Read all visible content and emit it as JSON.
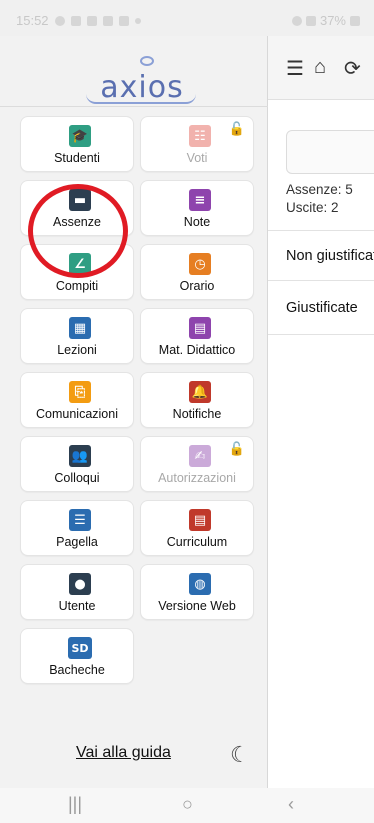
{
  "status_bar": {
    "time": "15:52",
    "battery": "37%"
  },
  "drawer": {
    "logo_text": "axios",
    "tiles": [
      {
        "label": "Studenti",
        "icon": "graduation-cap-icon",
        "color": "#2f9e83",
        "disabled": false
      },
      {
        "label": "Voti",
        "icon": "gradebook-icon",
        "color": "#e2574c",
        "disabled": true
      },
      {
        "label": "Assenze",
        "icon": "bed-icon",
        "color": "#2c3e50",
        "disabled": false
      },
      {
        "label": "Note",
        "icon": "note-icon",
        "color": "#8e44ad",
        "disabled": false
      },
      {
        "label": "Compiti",
        "icon": "chart-board-icon",
        "color": "#2f9e83",
        "disabled": false
      },
      {
        "label": "Orario",
        "icon": "clock-icon",
        "color": "#e67e22",
        "disabled": false
      },
      {
        "label": "Lezioni",
        "icon": "lesson-board-icon",
        "color": "#2b6cb0",
        "disabled": false
      },
      {
        "label": "Mat. Didattico",
        "icon": "books-icon",
        "color": "#8e44ad",
        "disabled": false
      },
      {
        "label": "Comunicazioni",
        "icon": "pdf-icon",
        "color": "#f39c12",
        "disabled": false
      },
      {
        "label": "Notifiche",
        "icon": "bell-icon",
        "color": "#c0392b",
        "disabled": false
      },
      {
        "label": "Colloqui",
        "icon": "people-icon",
        "color": "#2c3e50",
        "disabled": false
      },
      {
        "label": "Autorizzazioni",
        "icon": "signature-icon",
        "color": "#8e44ad",
        "disabled": true
      },
      {
        "label": "Pagella",
        "icon": "report-card-icon",
        "color": "#2b6cb0",
        "disabled": false
      },
      {
        "label": "Curriculum",
        "icon": "curriculum-icon",
        "color": "#c0392b",
        "disabled": false
      },
      {
        "label": "Utente",
        "icon": "user-icon",
        "color": "#2c3e50",
        "disabled": false
      },
      {
        "label": "Versione Web",
        "icon": "globe-icon",
        "color": "#2b6cb0",
        "disabled": false
      },
      {
        "label": "Bacheche",
        "icon": "sd-icon",
        "color": "#2b6cb0",
        "disabled": false
      }
    ],
    "guide_link": "Vai alla guida"
  },
  "main": {
    "assenze": "Assenze: 5",
    "uscite": "Uscite: 2",
    "row1": "Non giustificate",
    "row2": "Giustificate"
  }
}
